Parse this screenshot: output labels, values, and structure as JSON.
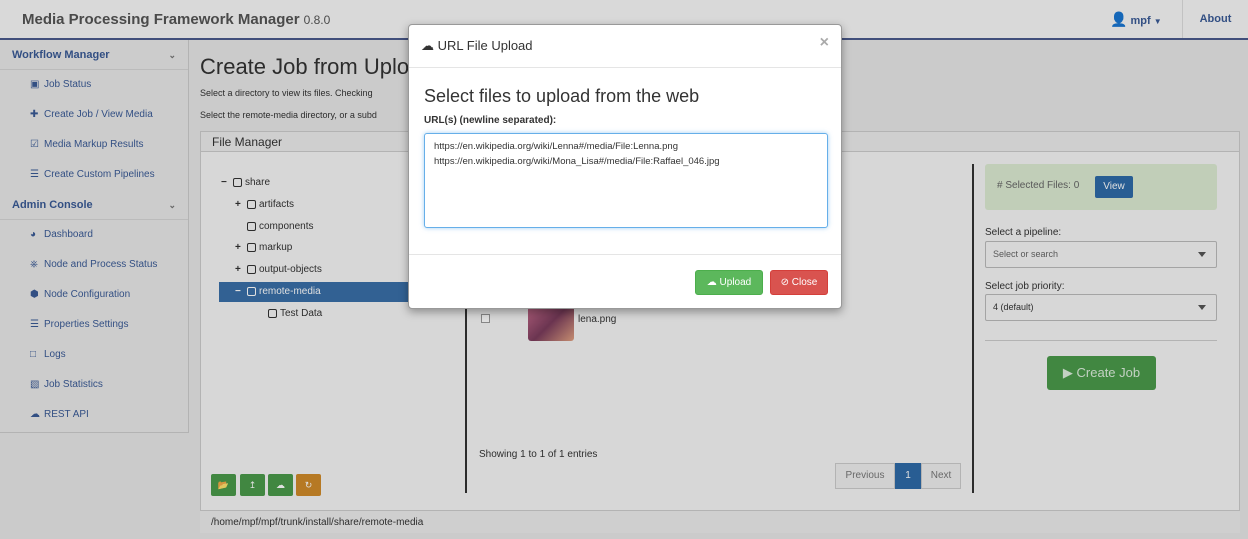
{
  "app": {
    "title": "Media Processing Framework Manager",
    "version": "0.8.0",
    "user": "mpf",
    "about": "About"
  },
  "sidebar": {
    "sections": [
      {
        "title": "Workflow Manager",
        "items": [
          {
            "label": "Job Status",
            "icon": "briefcase-icon"
          },
          {
            "label": "Create Job / View Media",
            "icon": "plus-icon"
          },
          {
            "label": "Media Markup Results",
            "icon": "check-square-icon"
          },
          {
            "label": "Create Custom Pipelines",
            "icon": "list-icon"
          }
        ]
      },
      {
        "title": "Admin Console",
        "items": [
          {
            "label": "Dashboard",
            "icon": "dashboard-icon"
          },
          {
            "label": "Node and Process Status",
            "icon": "network-icon"
          },
          {
            "label": "Node Configuration",
            "icon": "cube-icon"
          },
          {
            "label": "Properties Settings",
            "icon": "sliders-icon"
          },
          {
            "label": "Logs",
            "icon": "file-icon"
          },
          {
            "label": "Job Statistics",
            "icon": "bar-chart-icon"
          },
          {
            "label": "REST API",
            "icon": "cloud-icon"
          }
        ]
      }
    ]
  },
  "main": {
    "title": "Create Job from Uplo",
    "sub1": "Select a directory to view its files. Checking",
    "sub2": "Select the remote-media directory, or a subd"
  },
  "file_manager": {
    "title": "File Manager",
    "tree": [
      {
        "label": "share",
        "toggle": "−"
      },
      {
        "label": "artifacts",
        "toggle": "+"
      },
      {
        "label": "components",
        "toggle": ""
      },
      {
        "label": "markup",
        "toggle": "+"
      },
      {
        "label": "output-objects",
        "toggle": "+"
      },
      {
        "label": "remote-media",
        "toggle": "−"
      },
      {
        "label": "Test Data",
        "toggle": ""
      }
    ],
    "path": "/home/mpf/mpf/trunk/install/share/remote-media",
    "file_name": "lena.png",
    "showing": "Showing 1 to 1 of 1 entries",
    "pager": {
      "previous": "Previous",
      "page": "1",
      "next": "Next"
    }
  },
  "right_panel": {
    "selected_files": "# Selected Files: 0",
    "view": "View",
    "pipeline_label": "Select a pipeline:",
    "pipeline_placeholder": "Select or search",
    "priority_label": "Select job priority:",
    "priority_value": "4 (default)",
    "create_job": "Create Job"
  },
  "modal": {
    "title": "URL File Upload",
    "close_x": "×",
    "heading": "Select files to upload from the web",
    "label": "URL(s) (newline separated):",
    "urls": "https://en.wikipedia.org/wiki/Lenna#/media/File:Lenna.png\nhttps://en.wikipedia.org/wiki/Mona_Lisa#/media/File:Raffael_046.jpg",
    "upload": "Upload",
    "close": "Close"
  },
  "colors": {
    "accent": "#3a5a96",
    "success": "#5cb85c",
    "danger": "#d9534f",
    "primary": "#2e6aa8"
  }
}
